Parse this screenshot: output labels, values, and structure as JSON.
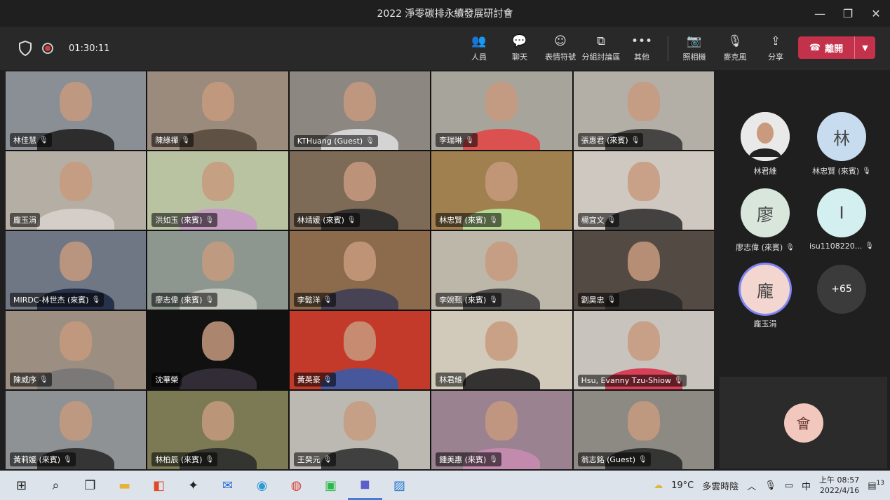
{
  "window": {
    "title": "2022 淨零碳排永續發展研討會",
    "min": "—",
    "max": "❐",
    "close": "✕"
  },
  "toolbar": {
    "timer": "01:30:11",
    "actions": [
      {
        "label": "人員",
        "icon": "people-icon",
        "glyph": "👥"
      },
      {
        "label": "聊天",
        "icon": "chat-icon",
        "glyph": "💬"
      },
      {
        "label": "表情符號",
        "icon": "reactions-icon",
        "glyph": "☺"
      },
      {
        "label": "分組討論區",
        "icon": "breakout-icon",
        "glyph": "⧉"
      },
      {
        "label": "其他",
        "icon": "more-icon",
        "glyph": "•••"
      }
    ],
    "media": [
      {
        "label": "照相機",
        "icon": "camera-off-icon",
        "glyph": "📷"
      },
      {
        "label": "麥克風",
        "icon": "mic-off-icon",
        "glyph": "🎙"
      },
      {
        "label": "分享",
        "icon": "share-icon",
        "glyph": "⇪"
      }
    ],
    "leave_label": "離開"
  },
  "participants": [
    {
      "name": "林佳慧",
      "bg": "#8a8f96",
      "shirt": "#222"
    },
    {
      "name": "陳綠禪",
      "bg": "#9b8b7c",
      "shirt": "#5a4a3f"
    },
    {
      "name": "KTHuang (Guest)",
      "bg": "#8d8782",
      "shirt": "#ddd"
    },
    {
      "name": "李瑞琳",
      "bg": "#a7a49b",
      "shirt": "#e04848"
    },
    {
      "name": "張惠君 (來賓)",
      "bg": "#b3aea6",
      "shirt": "#3a3a3a"
    },
    {
      "name": "龐玉涓",
      "bg": "#b5aea4",
      "shirt": "#d8d2cc"
    },
    {
      "name": "洪如玉 (來賓)",
      "bg": "#b9c3a2",
      "shirt": "#c89ac8"
    },
    {
      "name": "林靖媛 (來賓)",
      "bg": "#7d6a57",
      "shirt": "#2b2b2b"
    },
    {
      "name": "林忠賢 (來賓)",
      "bg": "#a0804f",
      "shirt": "#b9e39a"
    },
    {
      "name": "楊宜文",
      "bg": "#cfc8c0",
      "shirt": "#333"
    },
    {
      "name": "MIRDC-林世杰 (來賓)",
      "bg": "#6f7684",
      "shirt": "#1e2a44"
    },
    {
      "name": "廖志偉 (來賓)",
      "bg": "#8d9790",
      "shirt": "#c5c9c0"
    },
    {
      "name": "李懿洋",
      "bg": "#8c6b4c",
      "shirt": "#3f3f57"
    },
    {
      "name": "李婉甄 (來賓)",
      "bg": "#bdb7aa",
      "shirt": "#444"
    },
    {
      "name": "劉昊忠",
      "bg": "#544a44",
      "shirt": "#2a2a2a"
    },
    {
      "name": "陳威序",
      "bg": "#9c8f82",
      "shirt": "#777"
    },
    {
      "name": "沈華榮",
      "bg": "#111111",
      "shirt": "#35303a"
    },
    {
      "name": "黃英豪",
      "bg": "#c43a2a",
      "shirt": "#3a5ba8"
    },
    {
      "name": "林君維",
      "bg": "#d1c9b9",
      "shirt": "#222"
    },
    {
      "name": "Hsu, Evanny Tzu-Shiow",
      "bg": "#c8c4bd",
      "shirt": "#d8324a"
    },
    {
      "name": "黃莉媛 (來賓)",
      "bg": "#8f9294",
      "shirt": "#2b2b2b"
    },
    {
      "name": "林柏辰 (來賓)",
      "bg": "#7b7a55",
      "shirt": "#2c2c2c"
    },
    {
      "name": "王癸元",
      "bg": "#bcb8b2",
      "shirt": "#333"
    },
    {
      "name": "鍾美惠 (來賓)",
      "bg": "#9a8290",
      "shirt": "#c68bb0"
    },
    {
      "name": "翁志銘 (Guest)",
      "bg": "#8d8a84",
      "shirt": "#2b2b2b"
    }
  ],
  "side_avatars": [
    {
      "name": "林君維",
      "initial": "",
      "color": "#d9d9d9",
      "photo": true,
      "muted": false
    },
    {
      "name": "林忠賢 (來賓)",
      "initial": "林",
      "color": "#c7dcee",
      "muted": true
    },
    {
      "name": "廖志偉 (來賓)",
      "initial": "廖",
      "color": "#d8e6dc",
      "muted": true
    },
    {
      "name": "isu1108220...",
      "initial": "I",
      "color": "#d4efef",
      "muted": true
    },
    {
      "name": "龐玉涓",
      "initial": "龐",
      "color": "#f3d6cf",
      "muted": false,
      "speaking": true
    },
    {
      "name": "",
      "initial": "+65",
      "color": "#3b3b3b",
      "more": true
    }
  ],
  "self_view": {
    "initial": "會"
  },
  "taskbar": {
    "weather": "19°C",
    "condition": "多雲時陰",
    "ime": "中",
    "time": "上午 08:57",
    "date": "2022/4/16",
    "notifications": "13"
  }
}
